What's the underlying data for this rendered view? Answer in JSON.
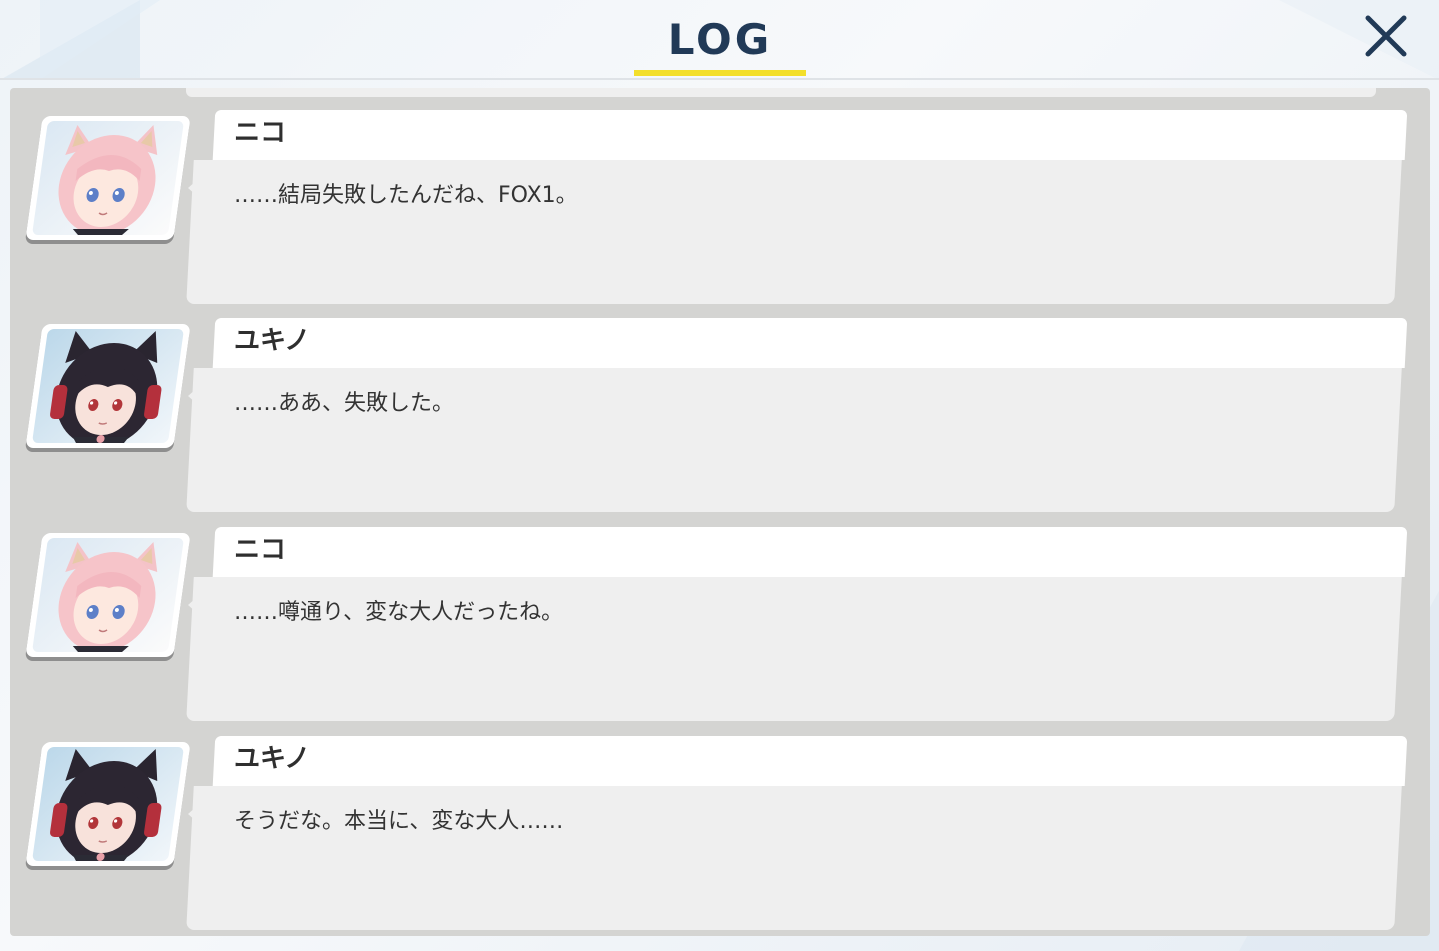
{
  "header": {
    "title": "LOG",
    "accent_color": "#f3df2b",
    "title_color": "#213a57",
    "close_icon": "close-icon"
  },
  "log": {
    "entries": [
      {
        "speaker": "ニコ",
        "portrait": "niko-portrait",
        "message": "……結局失敗したんだね、FOX1。"
      },
      {
        "speaker": "ユキノ",
        "portrait": "yukino-portrait",
        "message": "……ああ、失敗した。"
      },
      {
        "speaker": "ニコ",
        "portrait": "niko-portrait",
        "message": "……噂通り、変な大人だったね。"
      },
      {
        "speaker": "ユキノ",
        "portrait": "yukino-portrait",
        "message": "そうだな。本当に、変な大人……"
      }
    ]
  }
}
